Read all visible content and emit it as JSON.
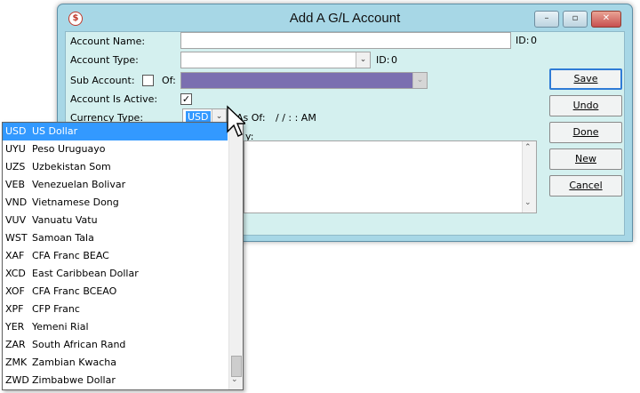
{
  "window": {
    "title": "Add A G/L Account",
    "app_icon_glyph": "$",
    "controls": {
      "minimize": "–",
      "maximize": "▫",
      "close": "✕"
    }
  },
  "form": {
    "account_name_label": "Account Name:",
    "account_name_value": "",
    "account_name_id_label": "ID:",
    "account_name_id_value": "0",
    "account_type_label": "Account Type:",
    "account_type_value": "",
    "account_type_id_label": "ID:",
    "account_type_id_value": "0",
    "sub_account_label": "Sub Account:",
    "sub_account_checked": false,
    "of_label": "Of:",
    "of_value": "",
    "active_label": "Account Is Active:",
    "active_checked": true,
    "currency_type_label": "Currency Type:",
    "currency_value": "USD",
    "as_of_label": "As Of:",
    "as_of_value": "/   /        :   :   AM",
    "notes_label_partial": "y:"
  },
  "buttons": {
    "save": "Save",
    "undo": "Undo",
    "done": "Done",
    "new": "New",
    "cancel": "Cancel"
  },
  "currency_list": [
    {
      "code": "USD",
      "name": "US Dollar",
      "selected": true
    },
    {
      "code": "UYU",
      "name": "Peso Uruguayo"
    },
    {
      "code": "UZS",
      "name": "Uzbekistan Som"
    },
    {
      "code": "VEB",
      "name": "Venezuelan Bolivar"
    },
    {
      "code": "VND",
      "name": "Vietnamese Dong"
    },
    {
      "code": "VUV",
      "name": "Vanuatu Vatu"
    },
    {
      "code": "WST",
      "name": "Samoan Tala"
    },
    {
      "code": "XAF",
      "name": "CFA Franc BEAC"
    },
    {
      "code": "XCD",
      "name": "East Caribbean Dollar"
    },
    {
      "code": "XOF",
      "name": "CFA Franc BCEAO"
    },
    {
      "code": "XPF",
      "name": "CFP Franc"
    },
    {
      "code": "YER",
      "name": "Yemeni Rial"
    },
    {
      "code": "ZAR",
      "name": "South African Rand"
    },
    {
      "code": "ZMK",
      "name": "Zambian Kwacha"
    },
    {
      "code": "ZWD",
      "name": "Zimbabwe Dollar"
    }
  ],
  "colors": {
    "window_frame": "#a7d7e6",
    "client_bg": "#d4f0ef",
    "selection": "#3399ff",
    "of_field_fill": "#7b6fb0"
  },
  "icons": {
    "combo_arrow": "⌄",
    "scroll_up": "⌃",
    "scroll_down": "⌄"
  }
}
